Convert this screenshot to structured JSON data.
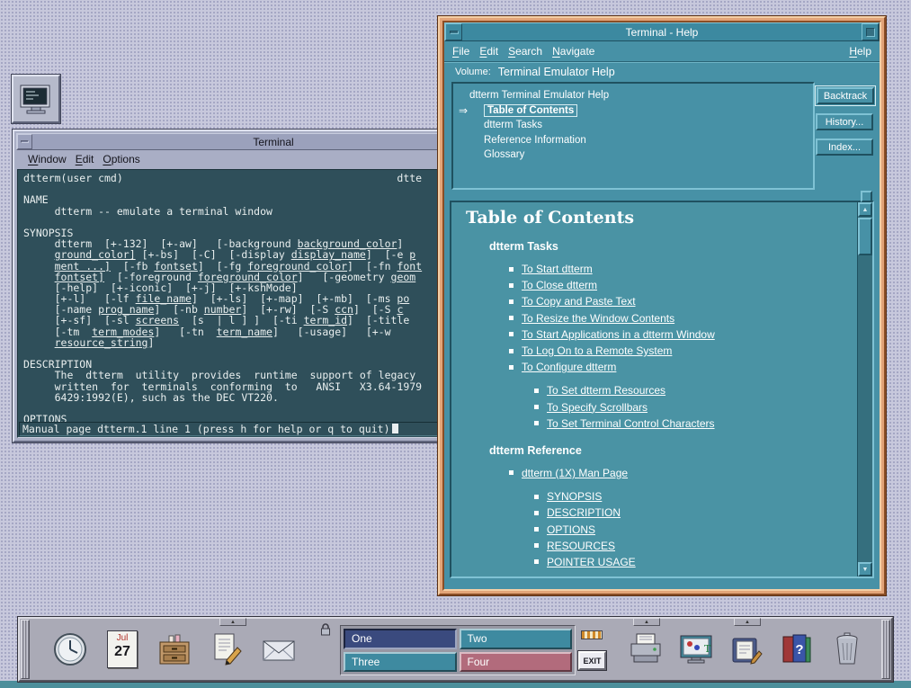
{
  "icons": {
    "help_glyph": "?",
    "style_glyph": "T",
    "subpanel_arrow": "▲",
    "scroll_up": "▲",
    "scroll_down": "▼",
    "current_topic_arrow": "⇒"
  },
  "colors": {
    "help_accent_teal": "#4791a6",
    "active_frame_peach": "#e2a478",
    "terminal_background": "#2f4f5a",
    "desktop": "#c7c8dc"
  },
  "terminal_window": {
    "title": "Terminal",
    "menus": [
      "Window",
      "Edit",
      "Options"
    ],
    "status_line": "Manual page dtterm.1 line 1 (press h for help or q to quit)",
    "lines": [
      [
        {
          "t": "dtterm(user cmd)                                            dtte",
          "u": false
        }
      ],
      [],
      [
        {
          "t": "NAME",
          "u": false
        }
      ],
      [
        {
          "t": "     dtterm -- emulate a terminal window",
          "u": false
        }
      ],
      [],
      [
        {
          "t": "SYNOPSIS",
          "u": false
        }
      ],
      [
        {
          "t": "     dtterm  [+-132]  [+-aw]   [-background ",
          "u": false
        },
        {
          "t": "background_color",
          "u": true
        },
        {
          "t": "]",
          "u": false
        }
      ],
      [
        {
          "t": "     ",
          "u": false
        },
        {
          "t": "ground_color]",
          "u": true
        },
        {
          "t": " [+-bs]  [-C]  [-display ",
          "u": false
        },
        {
          "t": "display_name",
          "u": true
        },
        {
          "t": "]  [-e ",
          "u": false
        },
        {
          "t": "p",
          "u": true
        }
      ],
      [
        {
          "t": "     ",
          "u": false
        },
        {
          "t": "ment ...]",
          "u": true
        },
        {
          "t": "  [-fb ",
          "u": false
        },
        {
          "t": "fontset",
          "u": true
        },
        {
          "t": "]  [-fg ",
          "u": false
        },
        {
          "t": "foreground_color",
          "u": true
        },
        {
          "t": "]  [-fn ",
          "u": false
        },
        {
          "t": "font",
          "u": true
        }
      ],
      [
        {
          "t": "     ",
          "u": false
        },
        {
          "t": "fontset]",
          "u": true
        },
        {
          "t": "  [-foreground ",
          "u": false
        },
        {
          "t": "foreground_color",
          "u": true
        },
        {
          "t": "]   [-geometry ",
          "u": false
        },
        {
          "t": "geom",
          "u": true
        }
      ],
      [
        {
          "t": "     [-help]  [+-iconic]  [+-j]  [+-kshMode]",
          "u": false
        }
      ],
      [
        {
          "t": "     [+-l]   [-lf ",
          "u": false
        },
        {
          "t": "file_name",
          "u": true
        },
        {
          "t": "]  [+-ls]  [+-map]  [+-mb]  [-ms ",
          "u": false
        },
        {
          "t": "po",
          "u": true
        }
      ],
      [
        {
          "t": "     [-name ",
          "u": false
        },
        {
          "t": "prog_name",
          "u": true
        },
        {
          "t": "]  [-nb ",
          "u": false
        },
        {
          "t": "number",
          "u": true
        },
        {
          "t": "]  [+-rw]  [-S ",
          "u": false
        },
        {
          "t": "ccn",
          "u": true
        },
        {
          "t": "]  [-S ",
          "u": false
        },
        {
          "t": "c",
          "u": true
        }
      ],
      [
        {
          "t": "     [+-sf]  [-sl ",
          "u": false
        },
        {
          "t": "screens",
          "u": true
        },
        {
          "t": "  [s  | l ] ]  [-ti ",
          "u": false
        },
        {
          "t": "term_id",
          "u": true
        },
        {
          "t": "]  [-title ",
          "u": false
        }
      ],
      [
        {
          "t": "     [-tm  ",
          "u": false
        },
        {
          "t": "term_modes",
          "u": true
        },
        {
          "t": "]   [-tn  ",
          "u": false
        },
        {
          "t": "term_name",
          "u": true
        },
        {
          "t": "]   [-usage]   [+-w",
          "u": false
        }
      ],
      [
        {
          "t": "     ",
          "u": false
        },
        {
          "t": "resource_string",
          "u": true
        },
        {
          "t": "]",
          "u": false
        }
      ],
      [],
      [
        {
          "t": "DESCRIPTION",
          "u": false
        }
      ],
      [
        {
          "t": "     The  dtterm  utility  provides  runtime  support of legacy",
          "u": false
        }
      ],
      [
        {
          "t": "     written  for  terminals  conforming  to   ANSI   X3.64-1979",
          "u": false
        }
      ],
      [
        {
          "t": "     6429:1992(E), such as the DEC VT220.",
          "u": false
        }
      ],
      [],
      [
        {
          "t": "OPTIONS",
          "u": false
        }
      ]
    ]
  },
  "help_window": {
    "title": "Terminal - Help",
    "menus": [
      "File",
      "Edit",
      "Search",
      "Navigate"
    ],
    "help_menu": "Help",
    "volume_label": "Volume:",
    "volume_value": "Terminal Emulator Help",
    "tree": {
      "items": [
        {
          "label": "dtterm Terminal Emulator Help",
          "level": 0,
          "selected": false
        },
        {
          "label": "Table of Contents",
          "level": 1,
          "selected": true
        },
        {
          "label": "dtterm Tasks",
          "level": 1,
          "selected": false
        },
        {
          "label": "Reference Information",
          "level": 1,
          "selected": false
        },
        {
          "label": "Glossary",
          "level": 1,
          "selected": false
        }
      ]
    },
    "buttons": [
      "Backtrack",
      "History...",
      "Index..."
    ],
    "content": {
      "title": "Table of Contents",
      "sections": [
        {
          "heading": "dtterm Tasks",
          "items": [
            {
              "label": "To Start dtterm",
              "level": 1
            },
            {
              "label": "To Close dtterm",
              "level": 1
            },
            {
              "label": "To Copy and Paste Text",
              "level": 1
            },
            {
              "label": "To Resize the Window Contents",
              "level": 1
            },
            {
              "label": "To Start Applications in a dtterm Window",
              "level": 1
            },
            {
              "label": "To Log On to a Remote System",
              "level": 1
            },
            {
              "label": "To Configure dtterm",
              "level": 1
            },
            {
              "label": "To Set dtterm Resources",
              "level": 2
            },
            {
              "label": "To Specify Scrollbars",
              "level": 2
            },
            {
              "label": "To Set Terminal Control Characters",
              "level": 2
            }
          ]
        },
        {
          "heading": "dtterm Reference",
          "items": [
            {
              "label": "dtterm (1X) Man Page",
              "level": 1
            },
            {
              "label": "SYNOPSIS",
              "level": 2
            },
            {
              "label": "DESCRIPTION",
              "level": 2
            },
            {
              "label": "OPTIONS",
              "level": 2
            },
            {
              "label": "RESOURCES",
              "level": 2
            },
            {
              "label": "POINTER USAGE",
              "level": 2
            }
          ]
        }
      ]
    }
  },
  "front_panel": {
    "calendar": {
      "month": "Jul",
      "day": "27"
    },
    "workspaces": [
      {
        "label": "One",
        "color": "#3a4a7e",
        "active": true
      },
      {
        "label": "Two",
        "color": "#3e8aa0",
        "active": false
      },
      {
        "label": "Three",
        "color": "#3e8aa0",
        "active": false
      },
      {
        "label": "Four",
        "color": "#b26b7c",
        "active": false
      }
    ],
    "exit_label": "EXIT"
  }
}
